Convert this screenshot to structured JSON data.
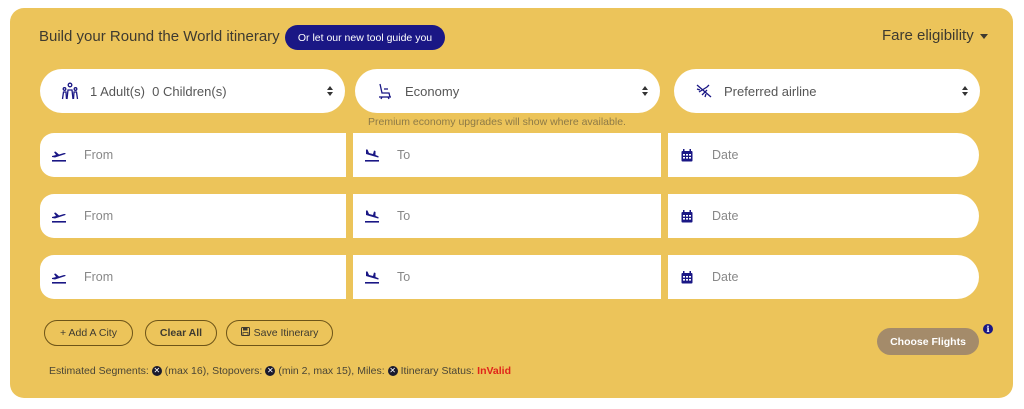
{
  "header": {
    "title": "Build your Round the World itinerary",
    "guide_button": "Or let our new tool guide you",
    "fare_eligibility": "Fare eligibility"
  },
  "selectors": {
    "passengers": "1 Adult(s)  0 Children(s)",
    "cabin": "Economy",
    "airline": "Preferred airline",
    "cabin_hint": "Premium economy upgrades will show where available."
  },
  "segments": [
    {
      "from_placeholder": "From",
      "to_placeholder": "To",
      "date_placeholder": "Date"
    },
    {
      "from_placeholder": "From",
      "to_placeholder": "To",
      "date_placeholder": "Date"
    },
    {
      "from_placeholder": "From",
      "to_placeholder": "To",
      "date_placeholder": "Date"
    }
  ],
  "actions": {
    "add_city": "+ Add A City",
    "clear_all": "Clear All",
    "save_itinerary": "Save Itinerary",
    "choose_flights": "Choose Flights"
  },
  "status": {
    "segments_label": "Estimated Segments:",
    "segments_limit": "(max 16),",
    "stopovers_label": "Stopovers:",
    "stopovers_limit": "(min 2, max 15),",
    "miles_label": "Miles:",
    "itinerary_label": "Itinerary Status:",
    "itinerary_value": "InValid"
  },
  "colors": {
    "panel": "#ecc45a",
    "accent": "#1a1785",
    "choose_button": "#a48b6a",
    "invalid": "#e0241a"
  },
  "icons": {
    "passengers": "family-icon",
    "cabin": "seat-icon",
    "airline": "plane-icon",
    "from": "takeoff-icon",
    "to": "landing-icon",
    "date": "calendar-icon"
  }
}
